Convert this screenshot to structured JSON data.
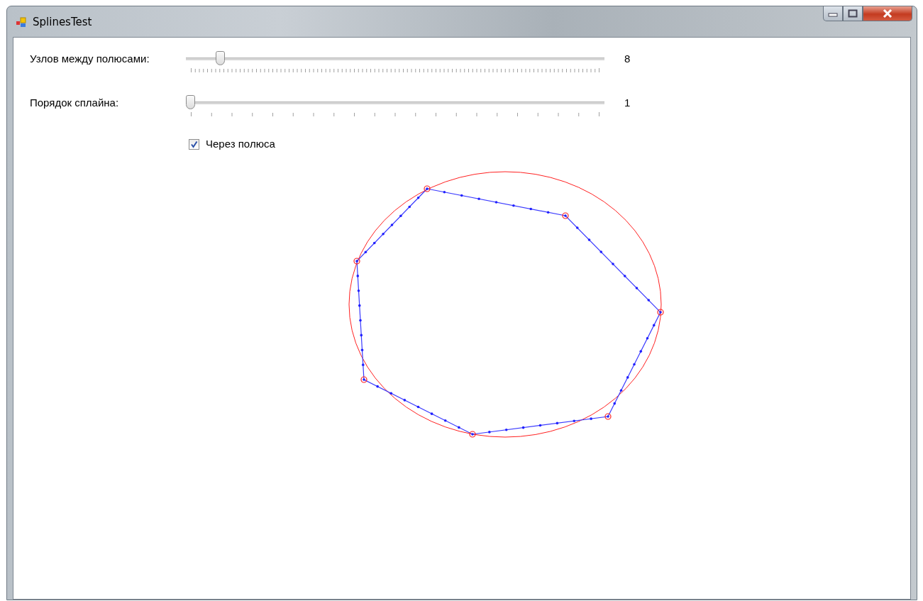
{
  "window": {
    "title": "SplinesTest"
  },
  "sliders": [
    {
      "label": "Узлов между полюсами:",
      "level": 0.073,
      "reading": "8"
    },
    {
      "label": "Порядок сплайна:",
      "level": 0,
      "reading": "1"
    }
  ],
  "checkbox": {
    "label": "Через полюса",
    "checked": true
  }
}
